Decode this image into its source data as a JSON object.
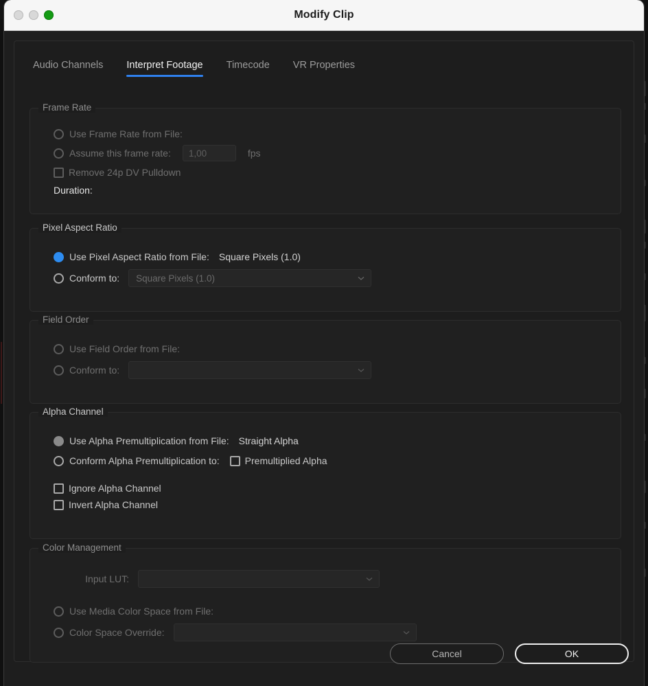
{
  "window": {
    "title": "Modify Clip",
    "traffic_lights": [
      "close-light",
      "minimize-light",
      "zoom-light"
    ]
  },
  "tabs": [
    {
      "label": "Audio Channels",
      "active": false
    },
    {
      "label": "Interpret Footage",
      "active": true
    },
    {
      "label": "Timecode",
      "active": false
    },
    {
      "label": "VR Properties",
      "active": false
    }
  ],
  "sections": {
    "frame_rate": {
      "legend": "Frame Rate",
      "use_from_file_label": "Use Frame Rate from File:",
      "use_from_file_value": "",
      "assume_label": "Assume this frame rate:",
      "assume_value": "1,00",
      "fps_unit": "fps",
      "remove_pulldown_label": "Remove 24p DV Pulldown",
      "duration_label": "Duration:",
      "duration_value": ""
    },
    "pixel_aspect_ratio": {
      "legend": "Pixel Aspect Ratio",
      "use_from_file_label": "Use Pixel Aspect Ratio from File:",
      "use_from_file_value": "Square Pixels (1.0)",
      "conform_label": "Conform to:",
      "conform_value": "Square Pixels (1.0)"
    },
    "field_order": {
      "legend": "Field Order",
      "use_from_file_label": "Use Field Order from File:",
      "use_from_file_value": "",
      "conform_label": "Conform to:",
      "conform_value": ""
    },
    "alpha_channel": {
      "legend": "Alpha Channel",
      "use_premult_label": "Use Alpha Premultiplication from File:",
      "use_premult_value": "Straight Alpha",
      "conform_premult_label": "Conform Alpha Premultiplication to:",
      "premultiplied_label": "Premultiplied Alpha",
      "ignore_label": "Ignore Alpha Channel",
      "invert_label": "Invert Alpha Channel"
    },
    "color_management": {
      "legend": "Color Management",
      "input_lut_label": "Input LUT:",
      "input_lut_value": "",
      "use_media_cs_label": "Use Media Color Space from File:",
      "use_media_cs_value": "",
      "cs_override_label": "Color Space Override:",
      "cs_override_value": ""
    }
  },
  "footer": {
    "cancel_label": "Cancel",
    "ok_label": "OK"
  },
  "colors": {
    "accent_blue": "#2f80ed",
    "radio_selected_blue": "#2d8cf0",
    "radio_selected_gray": "#8a8a8a",
    "window_chrome": "#f6f6f6",
    "panel_bg": "#1d1d1d",
    "zoom_light_green": "#149b14"
  }
}
